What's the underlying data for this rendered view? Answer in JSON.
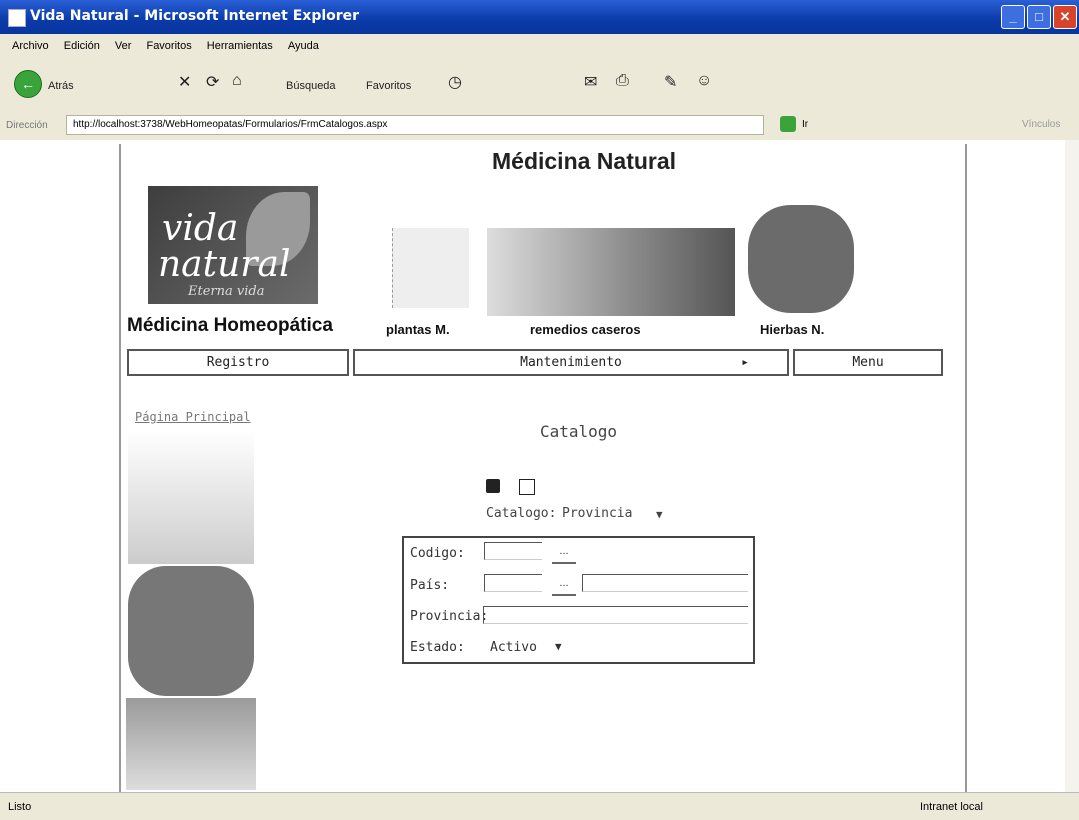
{
  "window": {
    "title": "Vida Natural - Microsoft Internet Explorer"
  },
  "menu": [
    "Archivo",
    "Edición",
    "Ver",
    "Favoritos",
    "Herramientas",
    "Ayuda"
  ],
  "toolbar": {
    "back": "Atrás",
    "search": "Búsqueda",
    "favorites": "Favoritos"
  },
  "address": {
    "label": "Dirección",
    "url": "http://localhost:3738/WebHomeopatas/Formularios/FrmCatalogos.aspx",
    "go": "Ir",
    "links": "Vínculos"
  },
  "page": {
    "header": "Médicina Natural",
    "logo": {
      "line1": "vida",
      "line2": "natural",
      "tag": "Eterna vida"
    },
    "subtitle": "Médicina Homeopática",
    "images": [
      "plantas M.",
      "remedios caseros",
      "Hierbas N."
    ],
    "nav": {
      "registro": "Registro",
      "mantenimiento": "Mantenimiento",
      "arrow": "▸",
      "menu": "Menu"
    },
    "link": "Página Principal",
    "title": "Catalogo",
    "catalog": {
      "label": "Catalogo:",
      "value": "Provincia"
    },
    "form": {
      "codigo": "Codigo:",
      "pais": "País:",
      "provincia": "Provincia:",
      "estado": "Estado:",
      "estado_value": "Activo",
      "dots": "..."
    }
  },
  "status": {
    "left": "Listo",
    "zone": "Intranet local"
  }
}
